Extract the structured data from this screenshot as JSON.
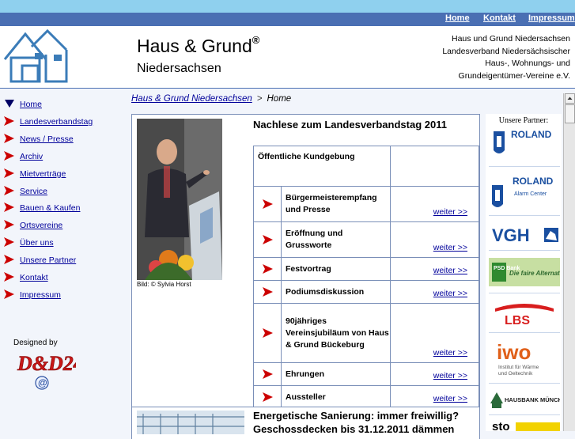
{
  "top_nav": {
    "items": [
      "Home",
      "Kontakt",
      "Impressum"
    ]
  },
  "header": {
    "logo_icon": "house-logo",
    "title": "Haus & Grund",
    "registered": "®",
    "subtitle": "Niedersachsen",
    "org_lines": [
      "Haus und Grund Niedersachsen",
      "Landesverband Niedersächsischer",
      "Haus-, Wohnungs- und",
      "Grundeigentümer-Vereine e.V."
    ]
  },
  "sidebar": {
    "items": [
      "Home",
      "Landesverbandstag",
      "News / Presse",
      "Archiv",
      "Mietverträge",
      "Service",
      "Bauen & Kaufen",
      "Ortsvereine",
      "Über uns",
      "Unsere Partner",
      "Kontakt",
      "Impressum"
    ],
    "active_index": 0,
    "designed_by": "Designed by",
    "designer_logo": "D&D24"
  },
  "breadcrumb": {
    "root": "Haus & Grund Niedersachsen",
    "separator": ">",
    "current": "Home"
  },
  "article": {
    "photo_caption": "Bild: © Sylvia Horst",
    "title": "Nachlese zum Landesverbandstag 2011",
    "program_header": "Öffentliche Kundgebung",
    "rows": [
      {
        "title": "Bürgermeisterempfang und Presse",
        "more": "weiter >>"
      },
      {
        "title": "Eröffnung und Grussworte",
        "more": "weiter >>"
      },
      {
        "title": "Festvortrag",
        "more": "weiter >>"
      },
      {
        "title": "Podiumsdiskussion",
        "more": "weiter >>"
      },
      {
        "title": "90jähriges Vereinsjubiläum von Haus & Grund Bückeburg",
        "more": "weiter >>"
      },
      {
        "title": "Ehrungen",
        "more": "weiter >>"
      },
      {
        "title": "Aussteller",
        "more": "weiter >>"
      }
    ]
  },
  "article2": {
    "title_line1": "Energetische Sanierung: immer freiwillig?",
    "title_line2": "Geschossdecken bis 31.12.2011 dämmen"
  },
  "partners": {
    "heading": "Unsere Partner:",
    "logos": [
      "ROLAND",
      "ROLAND Alarm Center",
      "VGH",
      "PSD Bank Die faire Alternative.",
      "LBS",
      "iwo Institut für Wärme und Oeltechnik",
      "HAUSBANK MÜNCHEN",
      "sto"
    ],
    "text": {
      "roland": "ROLAND",
      "alarm": "Alarm Center",
      "vgh": "VGH",
      "psd": "PSD Bank",
      "psd_claim": "Die faire Alternative.",
      "lbs": "LBS",
      "iwo": "iwo",
      "iwo_sub1": "Institut für Wärme",
      "iwo_sub2": "und Oeltechnik",
      "hausbank": "HAUSBANK MÜNCHEN",
      "sto": "sto"
    }
  },
  "colors": {
    "nav_bg": "#4a6fb3",
    "top_band": "#8fd0ee",
    "link": "#00009a",
    "arrow": "#cc0000",
    "active_arrow": "#000066"
  }
}
